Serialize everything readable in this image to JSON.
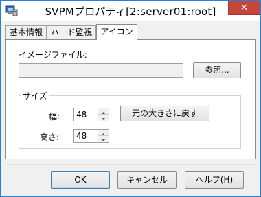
{
  "window": {
    "title": "SVPMプロパティ[2:server01:root]",
    "close_glyph": "✕"
  },
  "tabs": [
    {
      "label": "基本情報",
      "active": false
    },
    {
      "label": "ハード監視",
      "active": false
    },
    {
      "label": "アイコン",
      "active": true
    }
  ],
  "icon_tab": {
    "image_file_label": "イメージファイル:",
    "image_file_value": "",
    "browse_button": "参照...",
    "size_group_label": "サイズ",
    "width_label": "幅:",
    "width_value": "48",
    "height_label": "高さ:",
    "height_value": "48",
    "reset_size_button": "元の大きさに戻す"
  },
  "footer": {
    "ok_button": "OK",
    "cancel_button": "キャンセル",
    "help_button": "ヘルプ(H)"
  },
  "colors": {
    "titlebar": "#ffffff",
    "close_button": "#c7463b",
    "window_border": "#2b80d0",
    "dialog_background": "#f0f0f0"
  }
}
